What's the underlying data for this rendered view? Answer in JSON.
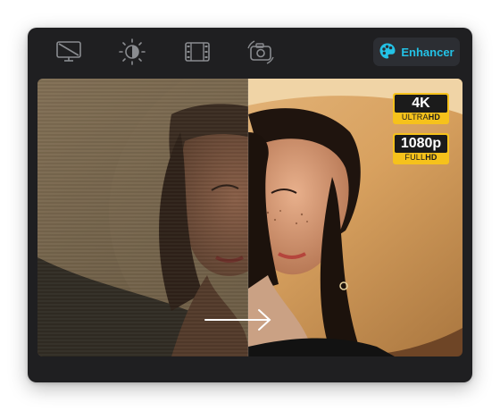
{
  "toolbar": {
    "tools": [
      {
        "name": "screen-off-icon"
      },
      {
        "name": "brightness-icon"
      },
      {
        "name": "film-icon"
      },
      {
        "name": "camera-rotate-icon"
      }
    ],
    "enhancer": {
      "label": "Enhancer",
      "icon": "palette-icon",
      "color": "#23c2e6"
    }
  },
  "viewer": {
    "comparison": "before-after split",
    "badges": [
      {
        "main": "4K",
        "sub_a": "ULTRA",
        "sub_b": "HD"
      },
      {
        "main": "1080p",
        "sub_a": "FULL",
        "sub_b": "HD"
      }
    ],
    "badge_color": "#f6c21b"
  }
}
